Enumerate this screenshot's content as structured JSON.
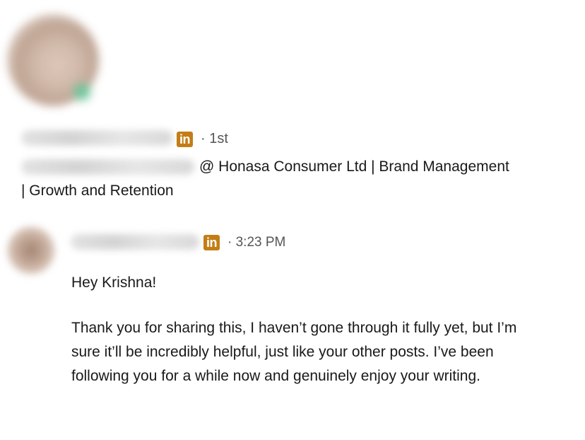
{
  "profile": {
    "degree": "· 1st",
    "headline_line1": "@ Honasa Consumer Ltd | Brand Management",
    "headline_line2": "| Growth and Retention",
    "linkedin_icon_text": "in"
  },
  "message": {
    "linkedin_icon_text": "in",
    "timestamp": "· 3:23 PM",
    "greeting": "Hey Krishna!",
    "body": "Thank you for sharing this, I haven’t gone through it fully yet, but I’m sure it’ll be incredibly helpful, just like your other posts. I’ve been following you for a while now and genuinely enjoy your writing."
  },
  "colors": {
    "linkedin_badge": "#c37d16",
    "text_primary": "#191919",
    "text_secondary": "#555555"
  }
}
